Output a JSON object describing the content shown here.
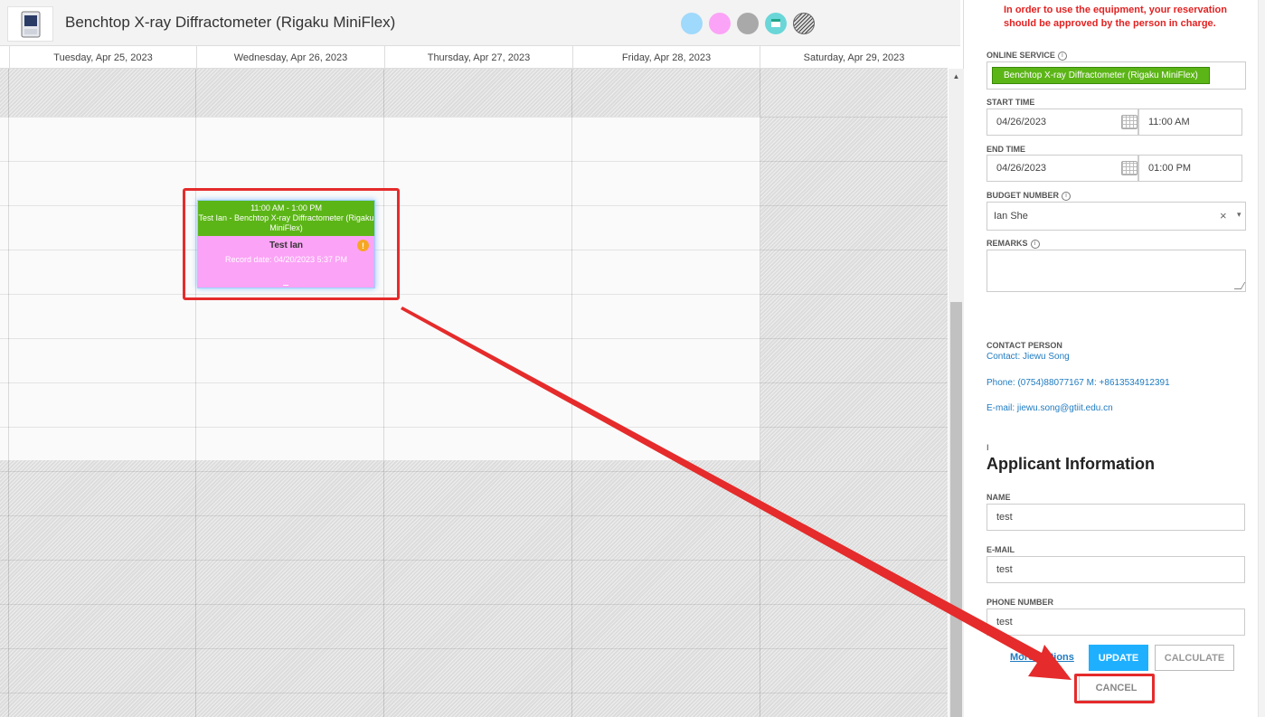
{
  "header": {
    "title": "Benchtop X-ray Diffractometer (Rigaku MiniFlex)",
    "legend_colors": [
      "#9fd9fb",
      "#fba3f6",
      "#a9a9a9",
      "#6ad6d8",
      "#444444"
    ]
  },
  "calendar": {
    "days": [
      "Tuesday, Apr 25, 2023",
      "Wednesday, Apr 26, 2023",
      "Thursday, Apr 27, 2023",
      "Friday, Apr 28, 2023",
      "Saturday, Apr 29, 2023"
    ],
    "event": {
      "time": "11:00 AM - 1:00 PM",
      "title": "Test Ian - Benchtop X-ray Diffractometer (Rigaku MiniFlex)",
      "name": "Test Ian",
      "record": "Record date: 04/20/2023 5:37 PM",
      "warn_symbol": "!"
    }
  },
  "form": {
    "notice": "In order to use the equipment, your reservation should be approved by the person in charge.",
    "online_service_label": "ONLINE SERVICE",
    "online_service_value": "Benchtop X-ray Diffractometer (Rigaku MiniFlex)",
    "start_time_label": "START TIME",
    "start_date": "04/26/2023",
    "start_time": "11:00 AM",
    "end_time_label": "END TIME",
    "end_date": "04/26/2023",
    "end_time": "01:00 PM",
    "budget_label": "BUDGET NUMBER",
    "budget_value": "Ian She",
    "budget_clear": "×",
    "budget_caret": "▾",
    "remarks_label": "REMARKS",
    "remarks_value": "",
    "contact_label": "CONTACT PERSON",
    "contact_name": "Contact: Jiewu Song",
    "contact_phone": "Phone: (0754)88077167  M: +8613534912391",
    "contact_email": "E-mail: jiewu.song@gtiit.edu.cn",
    "section_mark": "I",
    "applicant_title": "Applicant Information",
    "name_label": "NAME",
    "name_value": "test",
    "email_label": "E-MAIL",
    "email_value": "test",
    "phone_label": "PHONE NUMBER",
    "phone_value": "test",
    "more_options": "More Options",
    "update": "UPDATE",
    "calculate": "CALCULATE",
    "cancel": "CANCEL"
  }
}
